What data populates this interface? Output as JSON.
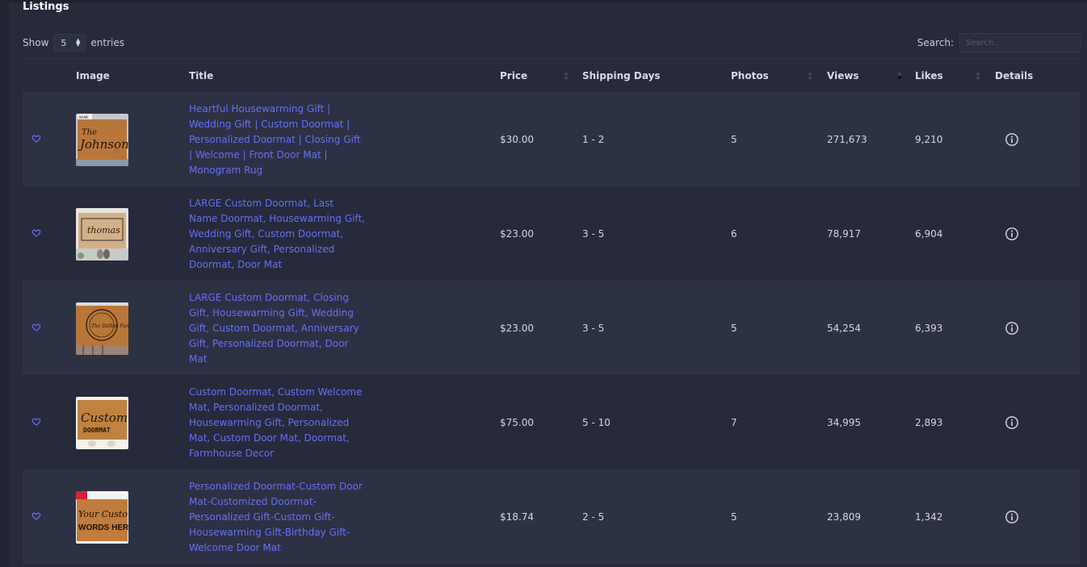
{
  "page": {
    "title": "Listings"
  },
  "controls": {
    "show_label": "Show",
    "entries_value": "5",
    "entries_label": "entries",
    "search_label": "Search:",
    "search_placeholder": "Search..."
  },
  "columns": [
    "Image",
    "Title",
    "Price",
    "Shipping Days",
    "Photos",
    "Views",
    "Likes",
    "Details"
  ],
  "sort_state": {
    "column": "Views",
    "direction": "desc"
  },
  "colors": {
    "link": "#6572f5",
    "background": "#262a3b",
    "row_alt": "#2d3144"
  },
  "rows": [
    {
      "title": "Heartful Housewarming Gift | Wedding Gift | Custom Doormat | Personalized Doormat | Closing Gift | Welcome | Front Door Mat | Monogram Rug",
      "price": "$30.00",
      "shipping": "1 - 2",
      "photos": "5",
      "views": "271,673",
      "likes": "9,210",
      "thumb": {
        "header": "NAME",
        "main": "The Johnsons"
      }
    },
    {
      "title": "LARGE Custom Doormat, Last Name Doormat, Housewarming Gift, Wedding Gift, Custom Doormat, Anniversary Gift, Personalized Doormat, Door Mat",
      "price": "$23.00",
      "shipping": "3 - 5",
      "photos": "6",
      "views": "78,917",
      "likes": "6,904",
      "thumb": {
        "main": "thomas"
      }
    },
    {
      "title": "LARGE Custom Doormat, Closing Gift, Housewarming Gift, Wedding Gift, Custom Doormat, Anniversary Gift, Personalized Doormat, Door Mat",
      "price": "$23.00",
      "shipping": "3 - 5",
      "photos": "5",
      "views": "54,254",
      "likes": "6,393",
      "thumb": {
        "main": "The Dalton Family"
      }
    },
    {
      "title": "Custom Doormat, Custom Welcome Mat, Personalized Doormat, Housewarming Gift, Personalized Mat, Custom Door Mat, Doormat, Farmhouse Decor",
      "price": "$75.00",
      "shipping": "5 - 10",
      "photos": "7",
      "views": "34,995",
      "likes": "2,893",
      "thumb": {
        "main": "Custom",
        "sub": "DOORMAT"
      }
    },
    {
      "title": "Personalized Doormat-Custom Door Mat-Customized Doormat-Personalized Gift-Custom Gift-Housewarming Gift-Birthday Gift-Welcome Door Mat",
      "price": "$18.74",
      "shipping": "2 - 5",
      "photos": "5",
      "views": "23,809",
      "likes": "1,342",
      "thumb": {
        "main": "Your Custom",
        "sub": "WORDS HERE"
      }
    }
  ]
}
